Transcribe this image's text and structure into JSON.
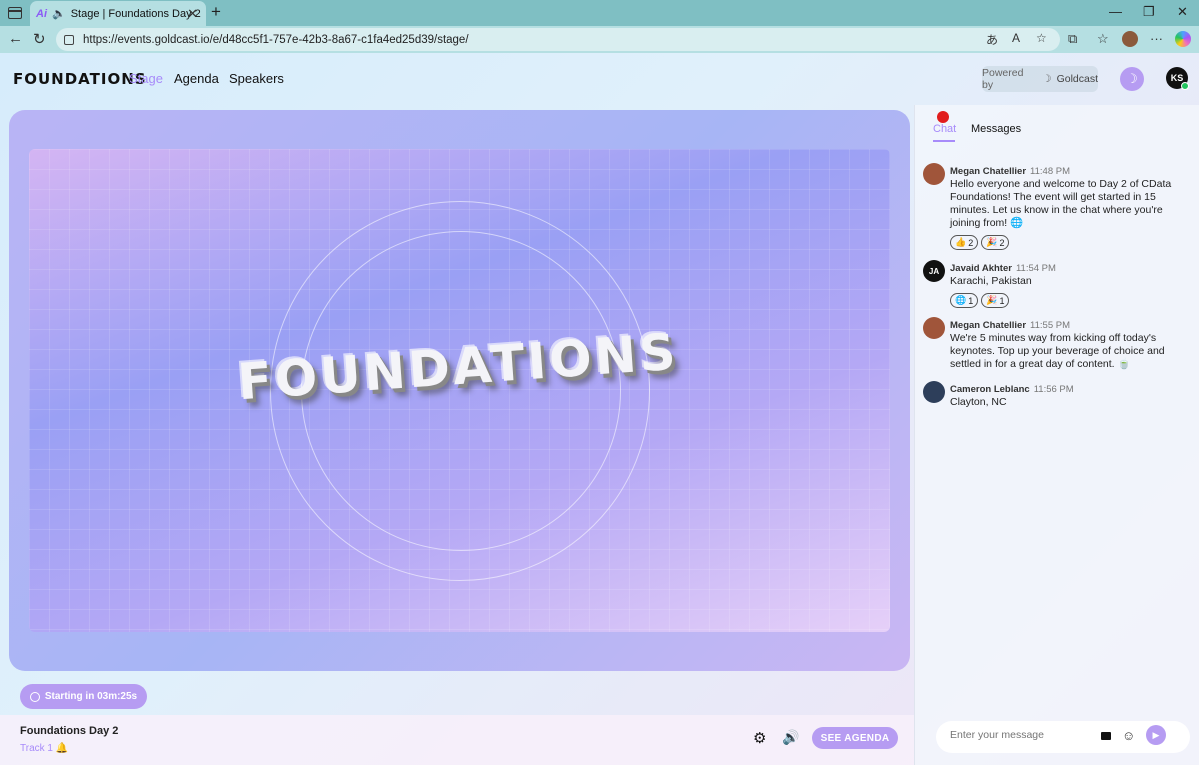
{
  "browser": {
    "tab_title": "Stage | Foundations Day 2",
    "url": "https://events.goldcast.io/e/d48cc5f1-757e-42b3-8a67-c1fa4ed25d39/stage/"
  },
  "site": {
    "logo": "FOUNDATIONS",
    "nav": [
      "Stage",
      "Agenda",
      "Speakers"
    ],
    "powered_label": "Powered by",
    "powered_brand": "Goldcast",
    "user_initials": "KS"
  },
  "stage": {
    "logo_text": "FOUNDATIONS",
    "countdown": "Starting in 03m:25s",
    "event_title": "Foundations Day 2",
    "track": "Track 1",
    "agenda_button": "SEE AGENDA"
  },
  "chat": {
    "tabs": [
      "Chat",
      "Messages"
    ],
    "messages": [
      {
        "name": "Megan Chatellier",
        "time": "11:48 PM",
        "text": "Hello everyone and welcome to Day 2 of  CData Foundations! The event will get started in 15 minutes. Let us know in the chat where you're joining from! 🌐",
        "reactions": [
          {
            "emoji": "👍",
            "count": "2"
          },
          {
            "emoji": "🎉",
            "count": "2"
          }
        ]
      },
      {
        "name": "Javaid Akhter",
        "initials": "JA",
        "time": "11:54 PM",
        "text": "Karachi, Pakistan",
        "reactions": [
          {
            "emoji": "🌐",
            "count": "1"
          },
          {
            "emoji": "🎉",
            "count": "1"
          }
        ]
      },
      {
        "name": "Megan Chatellier",
        "time": "11:55 PM",
        "text": "We're 5 minutes way from kicking off today's keynotes. Top up your beverage of choice and settled in for a great day of content. 🍵",
        "reactions": []
      },
      {
        "name": "Cameron Leblanc",
        "time": "11:56 PM",
        "text": "Clayton, NC",
        "reactions": []
      }
    ],
    "input_placeholder": "Enter your message"
  },
  "colors": {
    "accent": "#b69cf2",
    "active_link": "#a78bfa",
    "live_dot": "#e11d1d"
  }
}
